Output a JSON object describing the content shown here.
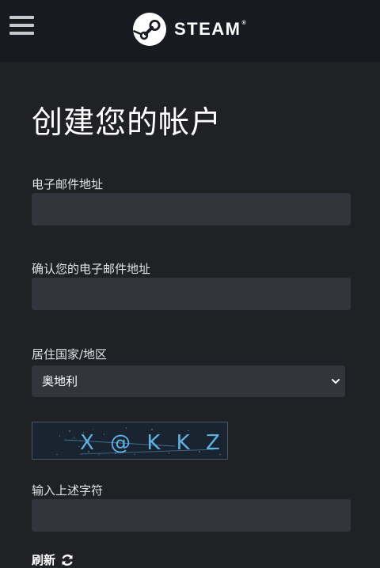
{
  "header": {
    "menu_icon": "hamburger-menu-icon",
    "logo_icon": "steam-logo-icon",
    "brand": "STEAM",
    "brand_mark": "®"
  },
  "form": {
    "title": "创建您的帐户",
    "email_label": "电子邮件地址",
    "email_value": "",
    "confirm_email_label": "确认您的电子邮件地址",
    "confirm_email_value": "",
    "country_label": "居住国家/地区",
    "country_selected": "奥地利",
    "country_chevron_icon": "chevron-down-icon",
    "captcha_image_text": "X @ K K Z &",
    "captcha_label": "输入上述字符",
    "captcha_value": "",
    "refresh_label": "刷新",
    "refresh_icon": "refresh-icon"
  },
  "colors": {
    "page_background": "#202125",
    "header_background": "#171a21",
    "input_background": "#32353c",
    "captcha_text": "#67c1f5"
  }
}
